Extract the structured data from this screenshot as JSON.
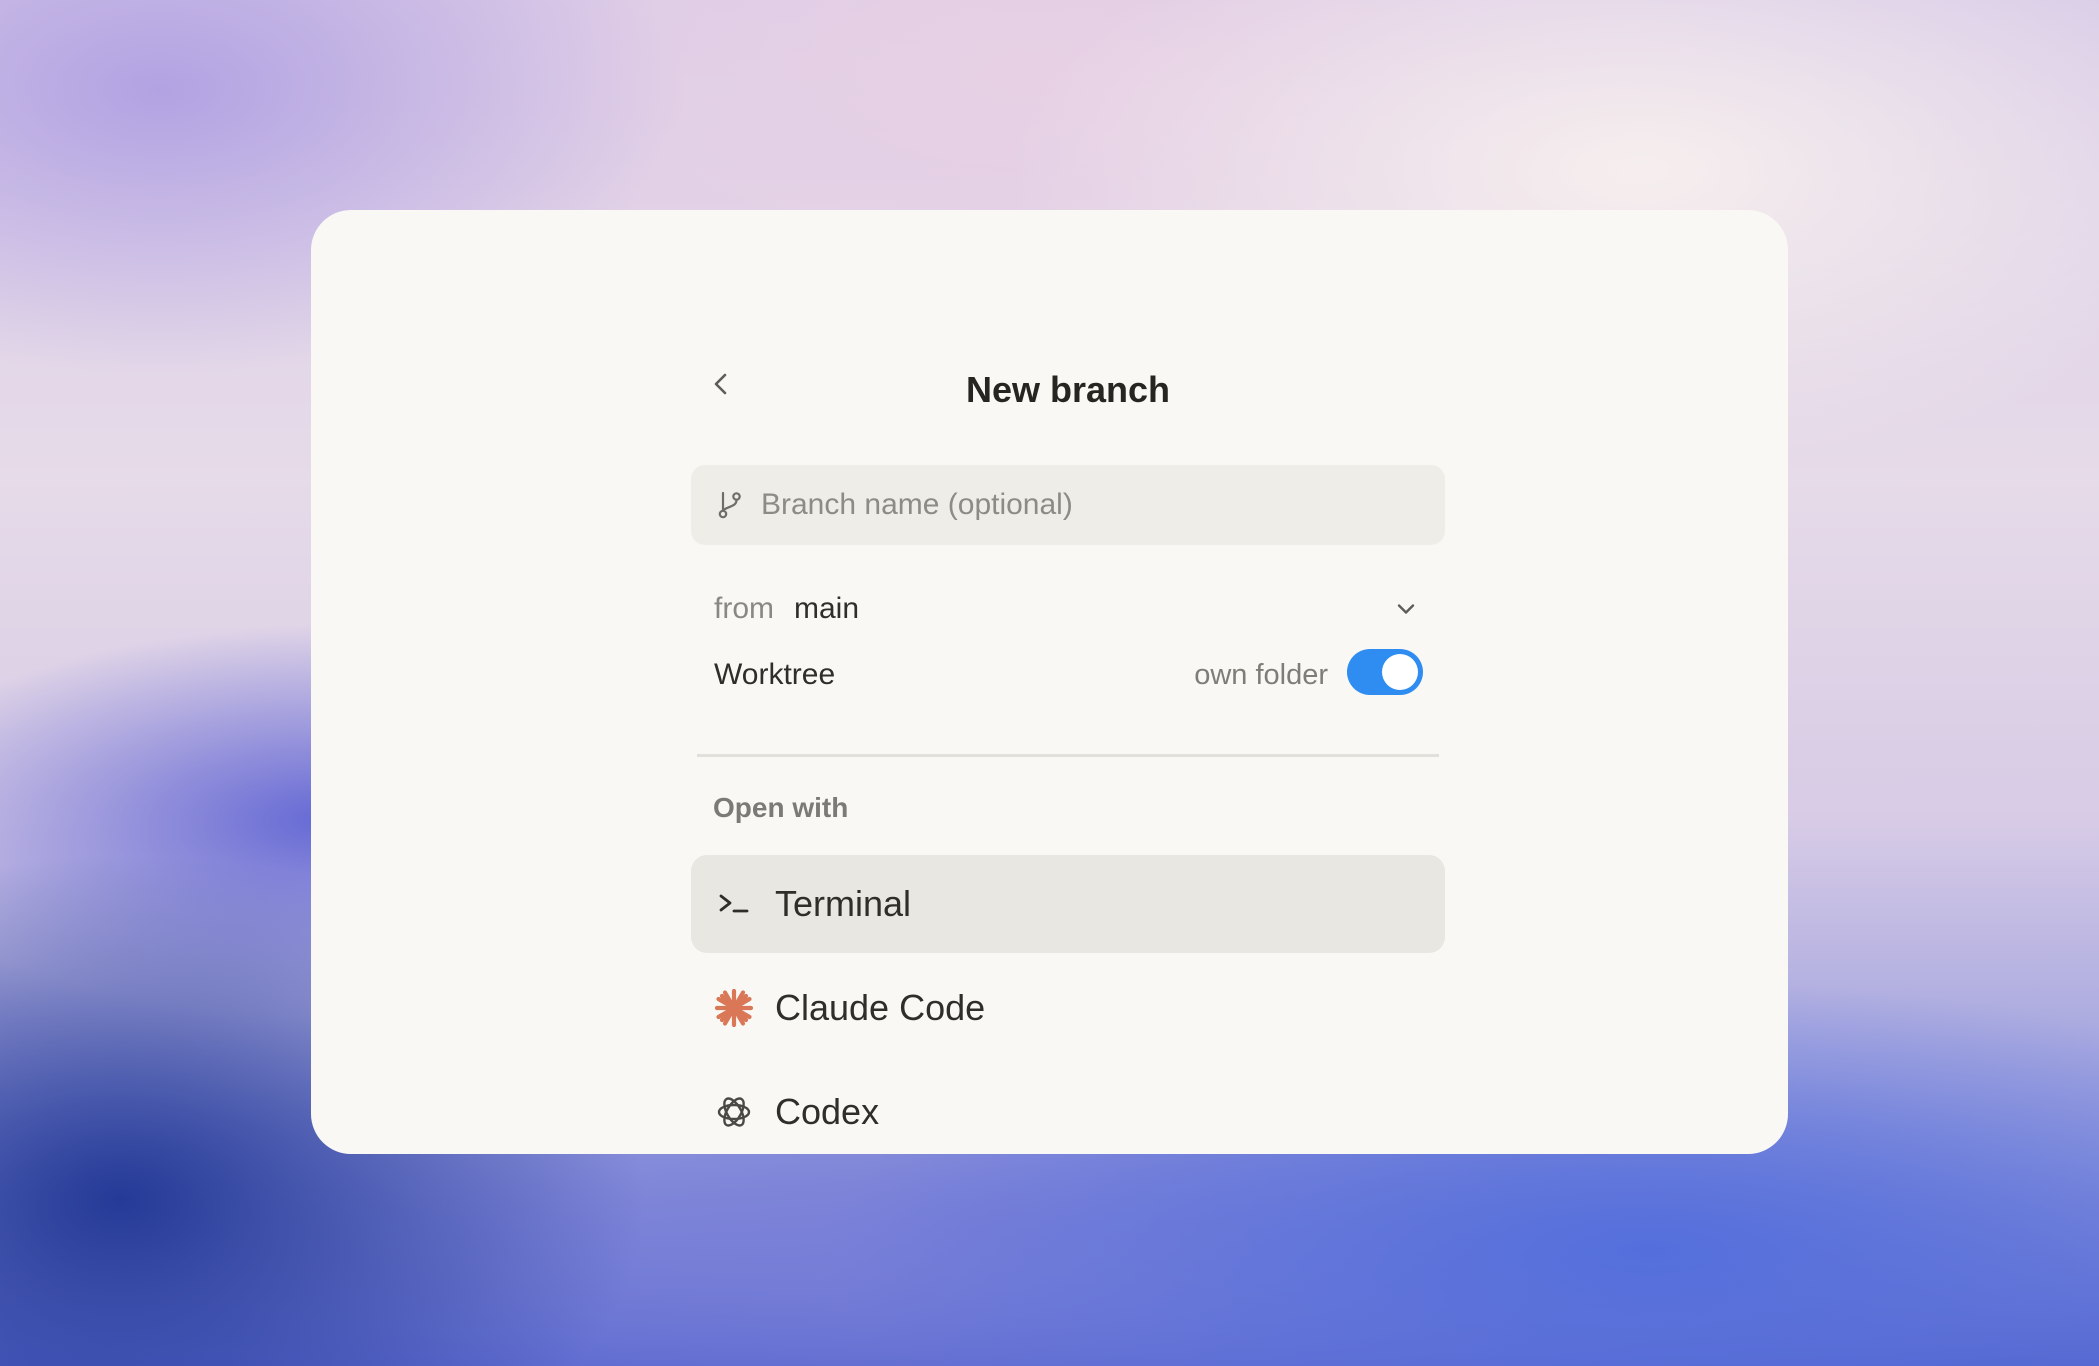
{
  "dialog": {
    "title": "New branch",
    "back_icon": "chevron-left-icon"
  },
  "branch_input": {
    "icon": "git-branch-icon",
    "placeholder": "Branch name (optional)",
    "value": ""
  },
  "base_branch": {
    "label": "from",
    "value": "main",
    "icon": "chevron-down-icon"
  },
  "worktree": {
    "label": "Worktree",
    "toggle_label": "own folder",
    "enabled": true,
    "toggle_color": "#2f8cf0"
  },
  "open_with": {
    "heading": "Open with",
    "options": [
      {
        "label": "Terminal",
        "icon": "terminal-icon",
        "selected": true
      },
      {
        "label": "Claude Code",
        "icon": "claude-asterisk-icon",
        "selected": false,
        "icon_color": "#d97757"
      },
      {
        "label": "Codex",
        "icon": "openai-knot-icon",
        "selected": false
      }
    ]
  }
}
